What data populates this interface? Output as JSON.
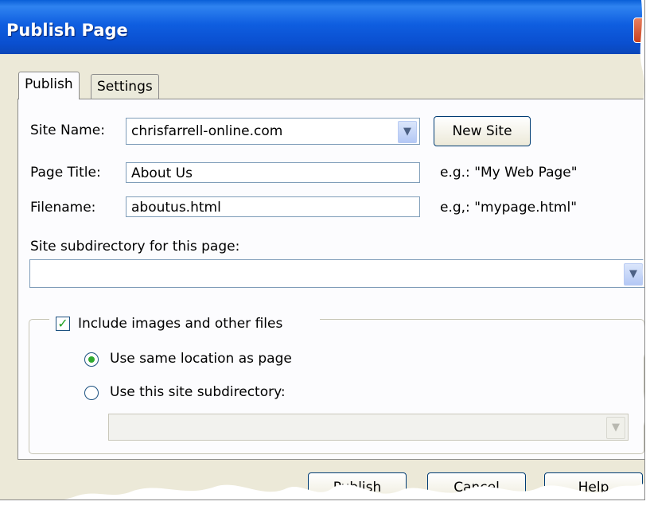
{
  "window": {
    "title": "Publish Page"
  },
  "tabs": [
    {
      "label": "Publish",
      "active": true
    },
    {
      "label": "Settings",
      "active": false
    }
  ],
  "form": {
    "site_name_label": "Site Name:",
    "site_name_value": "chrisfarrell-online.com",
    "new_site_label": "New Site",
    "page_title_label": "Page Title:",
    "page_title_value": "About Us",
    "page_title_hint": "e.g.: \"My Web Page\"",
    "filename_label": "Filename:",
    "filename_value": "aboutus.html",
    "filename_hint": "e.g,: \"mypage.html\"",
    "subdirectory_label": "Site subdirectory for this page:",
    "subdirectory_value": ""
  },
  "images_group": {
    "include_label": "Include images and other files",
    "include_checked": true,
    "radio_same_label": "Use same location as page",
    "radio_subdir_label": "Use this site subdirectory:",
    "selected": "same"
  },
  "buttons": {
    "publish": "Publish",
    "cancel": "Cancel",
    "help": "Help"
  },
  "icons": {
    "dropdown": "chevron-down-icon",
    "close": "close-icon",
    "check": "checkmark-icon"
  }
}
